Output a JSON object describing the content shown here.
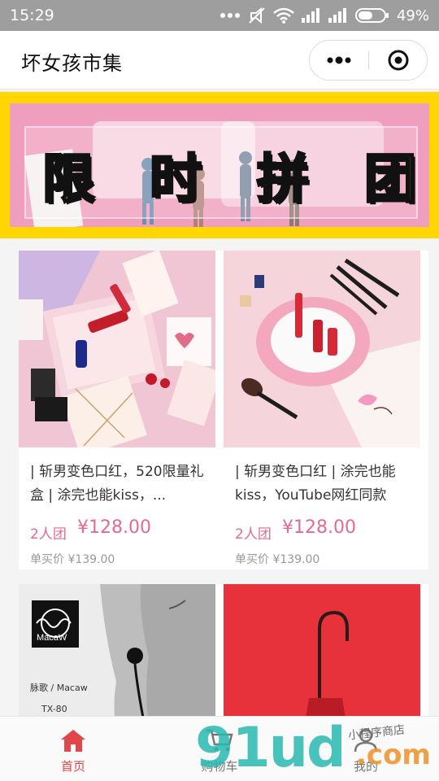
{
  "status_bar": {
    "time": "15:29",
    "battery": "49%",
    "icons": [
      "more-dots-icon",
      "mute-icon",
      "wifi-icon",
      "signal-icon",
      "signal-icon",
      "battery-icon"
    ]
  },
  "nav": {
    "title": "坏女孩市集",
    "more_icon": "more-dots-icon",
    "close_icon": "target-close-icon"
  },
  "banner": {
    "chars": [
      "限",
      "时",
      "拼",
      "团"
    ]
  },
  "products": [
    {
      "name": "| 斩男变色口红，520限量礼盒 | 涂完也能kiss，...",
      "group_label": "2人团",
      "group_price": "¥128.00",
      "single_price": "单买价 ¥139.00"
    },
    {
      "name": "| 斩男变色口红 | 涂完也能kiss，YouTube网红同款",
      "group_label": "2人团",
      "group_price": "¥128.00",
      "single_price": "单买价 ¥139.00"
    },
    {
      "image_text": {
        "logo": "MacaW",
        "line1": "脉歌 / Macaw",
        "line2": "TX-80"
      }
    },
    {}
  ],
  "tabs": [
    {
      "label": "首页",
      "icon": "home-icon",
      "active": true
    },
    {
      "label": "购物车",
      "icon": "cart-icon",
      "active": false
    },
    {
      "label": "我的",
      "icon": "user-icon",
      "active": false
    }
  ],
  "watermark": {
    "main": "91ud",
    "suffix": ".com",
    "small": "小程序商店"
  },
  "colors": {
    "accent": "#e56a93",
    "tab_active": "#e0464a",
    "banner_border": "#ffd600"
  }
}
